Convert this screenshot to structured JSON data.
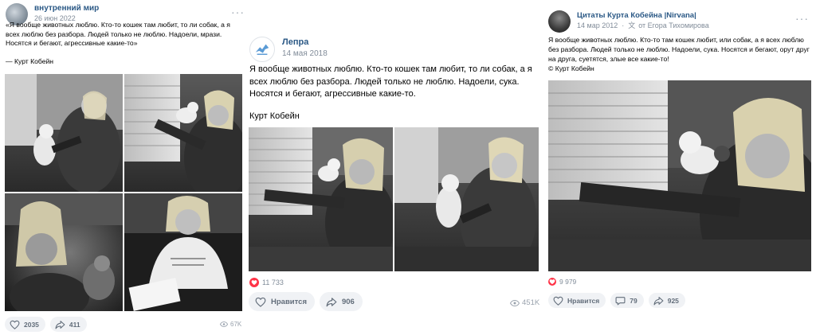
{
  "colors": {
    "link": "#2a5885",
    "muted": "#818c99",
    "button_bg": "#f0f2f5",
    "like_red": "#ff3347"
  },
  "posts": [
    {
      "group": "внутренний мир",
      "date": "26 июн 2022",
      "text": "«Я вообще животных люблю. Кто-то кошек там любит, то ли собак, а я всех люблю без разбора. Людей только не люблю. Надоели, мрази. Носятся и бегают, агрессивные какие-то»",
      "author": "— Курт Кобейн",
      "likes": "2035",
      "shares": "411",
      "views": "67K",
      "icons": {
        "like": "heart-icon",
        "share": "share-arrow-icon",
        "views": "eye-icon",
        "more": "more-dots-icon"
      }
    },
    {
      "group": "Лепра",
      "date": "14 мая 2018",
      "text": "Я вообще животных люблю. Кто-то кошек там любит, то ли собак, а я всех люблю без разбора. Людей только не люблю. Надоели, сука. Носятся и бегают, агрессивные какие-то.",
      "author": "Курт Кобейн",
      "likes_count": "11 733",
      "like_label": "Нравится",
      "shares": "906",
      "views": "451K",
      "icons": {
        "like": "heart-icon",
        "share": "share-arrow-icon",
        "views": "eye-icon",
        "avatar": "lepra-logo-icon"
      }
    },
    {
      "group": "Цитаты Курта Кобейна |Nirvana|",
      "date": "14 мар 2012",
      "author_by": "от Егора Тихомирова",
      "text_lines": [
        "Я вообще животных люблю. Кто-то там кошек любит, или собак, а я всех люблю",
        "без разбора. Людей только не люблю. Надоели, сука. Носятся и бегают, орут друг",
        "на друга, суетятся, злые все какие-то!",
        "© Курт Кобейн"
      ],
      "likes_count": "9 979",
      "like_label": "Нравится",
      "comments": "79",
      "shares": "925",
      "icons": {
        "like": "heart-icon",
        "comment": "comment-bubble-icon",
        "share": "share-arrow-icon",
        "translate": "translate-icon",
        "more": "more-dots-icon"
      }
    }
  ]
}
